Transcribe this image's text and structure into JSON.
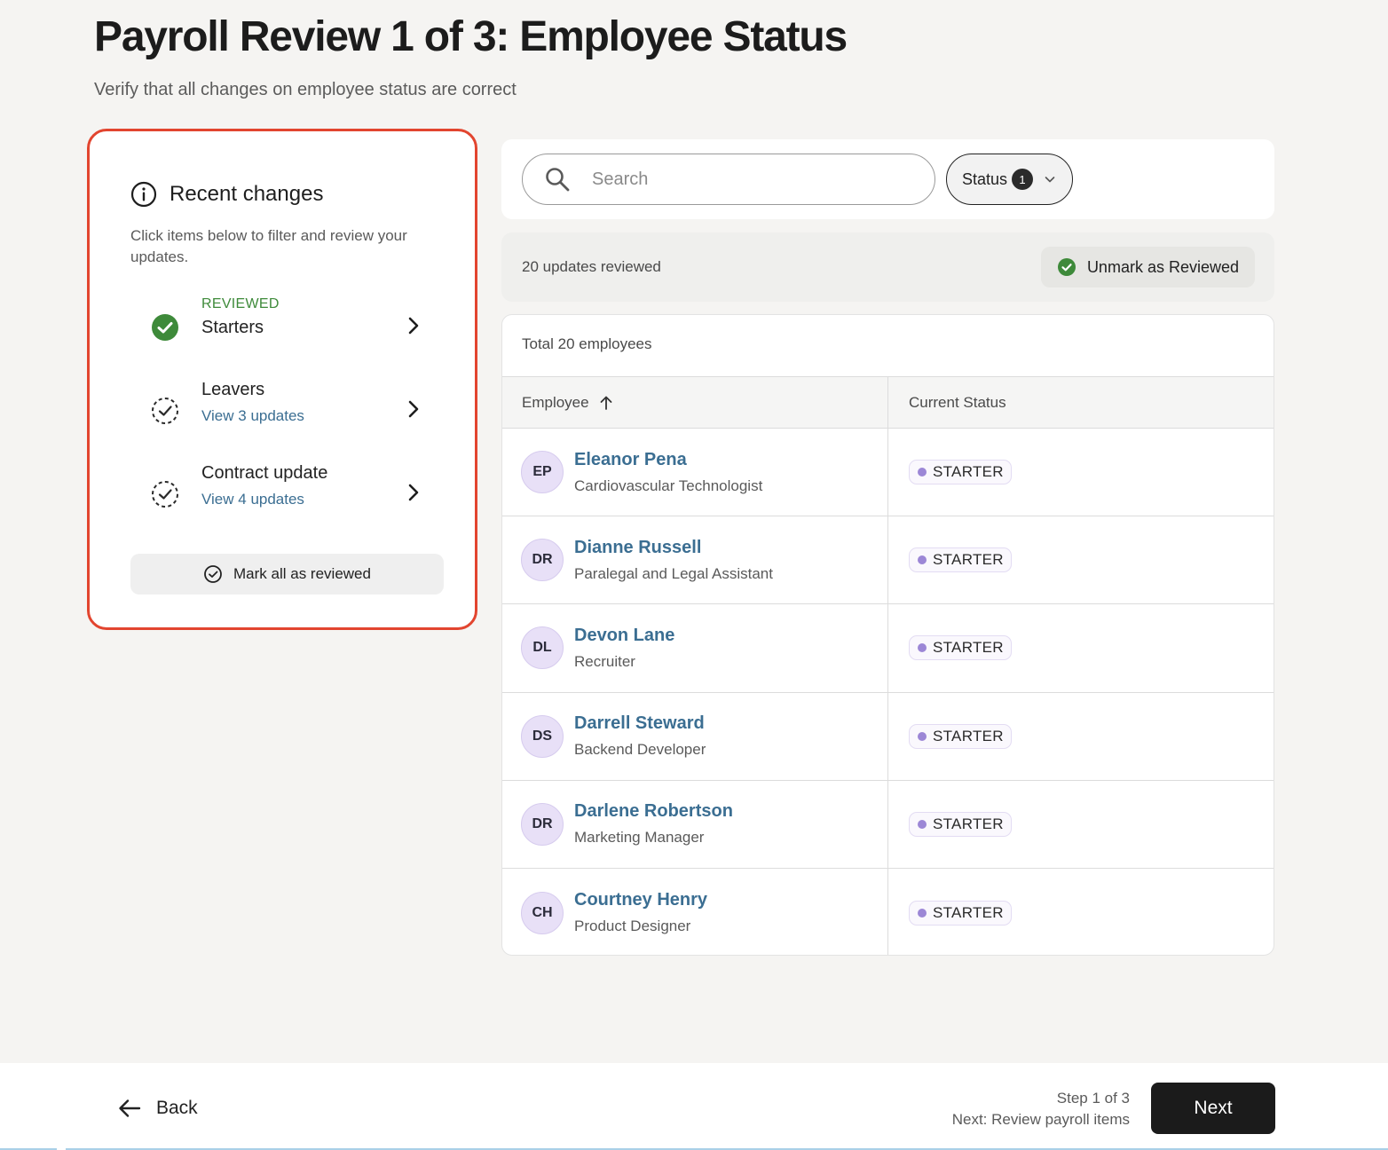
{
  "header": {
    "title": "Payroll Review 1 of 3: Employee Status",
    "subtitle": "Verify that all changes on employee status are correct"
  },
  "changes": {
    "title": "Recent changes",
    "description": "Click items below to filter and review your updates.",
    "items": [
      {
        "status": "REVIEWED",
        "name": "Starters",
        "link": ""
      },
      {
        "status": "",
        "name": "Leavers",
        "link": "View 3 updates"
      },
      {
        "status": "",
        "name": "Contract update",
        "link": "View 4 updates"
      }
    ],
    "mark_all_label": "Mark all as reviewed"
  },
  "filters": {
    "search_placeholder": "Search",
    "status_label": "Status",
    "status_count": "1"
  },
  "review_bar": {
    "text": "20 updates reviewed",
    "unmark_label": "Unmark as Reviewed"
  },
  "table": {
    "total_label": "Total 20 employees",
    "columns": [
      "Employee",
      "Current Status"
    ],
    "rows": [
      {
        "initials": "EP",
        "name": "Eleanor Pena",
        "role": "Cardiovascular Technologist",
        "status": "STARTER"
      },
      {
        "initials": "DR",
        "name": "Dianne Russell",
        "role": "Paralegal and Legal Assistant",
        "status": "STARTER"
      },
      {
        "initials": "DL",
        "name": "Devon Lane",
        "role": "Recruiter",
        "status": "STARTER"
      },
      {
        "initials": "DS",
        "name": "Darrell Steward",
        "role": "Backend Developer",
        "status": "STARTER"
      },
      {
        "initials": "DR",
        "name": "Darlene Robertson",
        "role": "Marketing Manager",
        "status": "STARTER"
      },
      {
        "initials": "CH",
        "name": "Courtney Henry",
        "role": "Product Designer",
        "status": "STARTER"
      }
    ]
  },
  "footer": {
    "back_label": "Back",
    "step_label": "Step 1 of 3",
    "next_step_label": "Next: Review payroll items",
    "next_label": "Next"
  },
  "colors": {
    "accent_border": "#e2452f",
    "reviewed_green": "#3e8a3a",
    "link_blue": "#3b6e92",
    "starter_dot": "#9c87d6"
  }
}
